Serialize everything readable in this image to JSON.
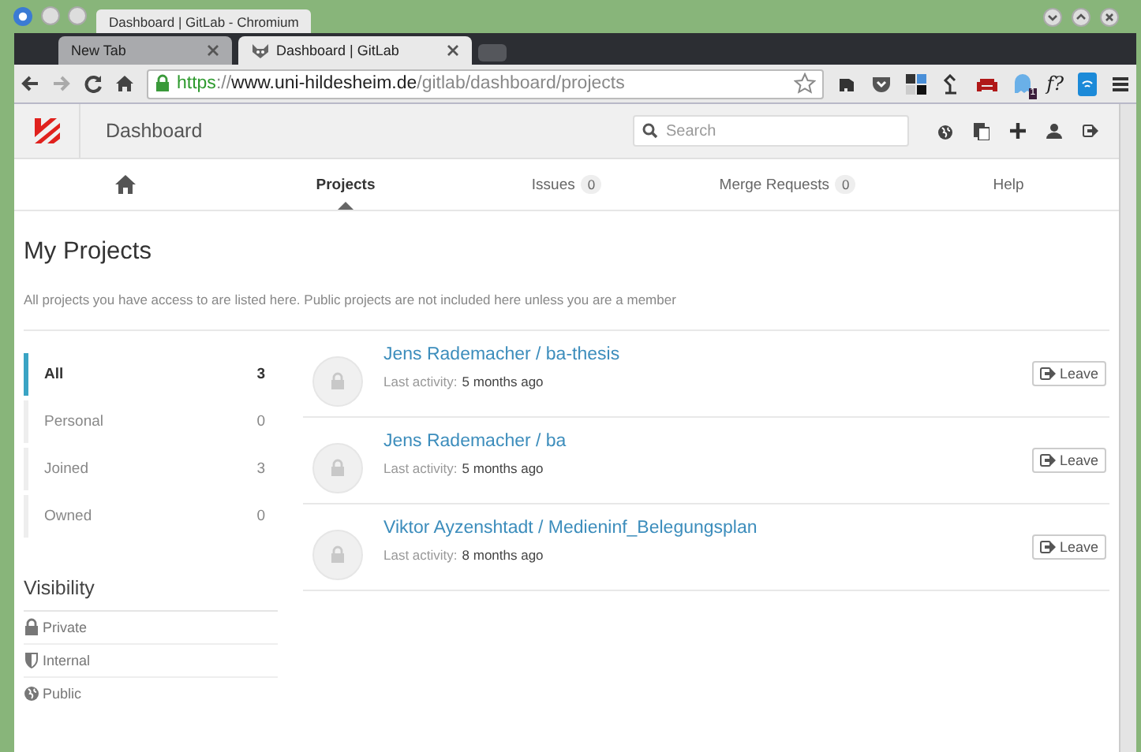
{
  "window": {
    "title": "Dashboard | GitLab - Chromium"
  },
  "tabs": [
    {
      "label": "New Tab",
      "selected": false
    },
    {
      "label": "Dashboard | GitLab",
      "selected": true
    }
  ],
  "url": [
    {
      "kind": "scheme",
      "text": "https"
    },
    {
      "kind": "sep",
      "text": "://"
    },
    {
      "kind": "host",
      "text": "www.uni-hildesheim.de"
    },
    {
      "kind": "path",
      "text": "/gitlab/dashboard/projects"
    }
  ],
  "extensions": {
    "badge": "1",
    "formula_label": "f?"
  },
  "header": {
    "title": "Dashboard",
    "search": {
      "placeholder": "Search"
    }
  },
  "nav": [
    {
      "kind": "home",
      "selected": false
    },
    {
      "kind": "text",
      "label": "Projects",
      "selected": true
    },
    {
      "kind": "text",
      "label": "Issues",
      "count": "0",
      "selected": false
    },
    {
      "kind": "text",
      "label": "Merge Requests",
      "count": "0",
      "selected": false
    },
    {
      "kind": "text",
      "label": "Help",
      "selected": false
    }
  ],
  "page": {
    "title": "My Projects",
    "description": "All projects you have access to are listed here. Public projects are not included here unless you are a member"
  },
  "filters": [
    {
      "label": "All",
      "count": "3",
      "selected": true
    },
    {
      "label": "Personal",
      "count": "0",
      "selected": false
    },
    {
      "label": "Joined",
      "count": "3",
      "selected": false
    },
    {
      "label": "Owned",
      "count": "0",
      "selected": false
    }
  ],
  "visibility": {
    "title": "Visibility",
    "items": [
      {
        "kind": "lock",
        "label": "Private"
      },
      {
        "kind": "shield",
        "label": "Internal"
      },
      {
        "kind": "globe",
        "label": "Public"
      }
    ]
  },
  "projects": [
    {
      "name": "Jens Rademacher / ba-thesis",
      "activity_label": "Last activity:",
      "activity": "5 months ago",
      "button": "Leave"
    },
    {
      "name": "Jens Rademacher / ba",
      "activity_label": "Last activity:",
      "activity": "5 months ago",
      "button": "Leave"
    },
    {
      "name": "Viktor Ayzenshtadt / Medieninf_Belegungsplan",
      "activity_label": "Last activity:",
      "activity": "8 months ago",
      "button": "Leave"
    }
  ]
}
